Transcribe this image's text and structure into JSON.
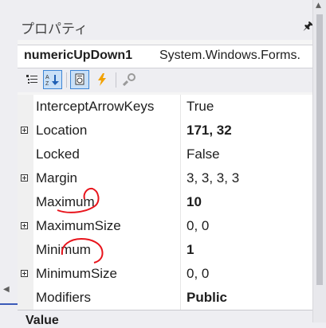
{
  "panel": {
    "title": "プロパティ",
    "pin_icon": "pin-icon"
  },
  "object": {
    "name": "numericUpDown1",
    "type": "System.Windows.Forms."
  },
  "toolbar": {
    "buttons": [
      {
        "icon": "categorized-icon",
        "active": false
      },
      {
        "icon": "alphabetical-icon",
        "active": true
      },
      {
        "icon": "properties-icon",
        "active": true
      },
      {
        "icon": "events-icon",
        "active": false
      },
      {
        "icon": "property-pages-icon",
        "active": false
      }
    ]
  },
  "properties": [
    {
      "name": "InterceptArrowKeys",
      "value": "True",
      "expandable": false,
      "bold": false
    },
    {
      "name": "Location",
      "value": "171, 32",
      "expandable": true,
      "bold": true
    },
    {
      "name": "Locked",
      "value": "False",
      "expandable": false,
      "bold": false
    },
    {
      "name": "Margin",
      "value": "3, 3, 3, 3",
      "expandable": true,
      "bold": false
    },
    {
      "name": "Maximum",
      "value": "10",
      "expandable": false,
      "bold": true
    },
    {
      "name": "MaximumSize",
      "value": "0, 0",
      "expandable": true,
      "bold": false
    },
    {
      "name": "Minimum",
      "value": "1",
      "expandable": false,
      "bold": true
    },
    {
      "name": "MinimumSize",
      "value": "0, 0",
      "expandable": true,
      "bold": false
    },
    {
      "name": "Modifiers",
      "value": "Public",
      "expandable": false,
      "bold": true
    }
  ],
  "description": {
    "label": "Value"
  },
  "colors": {
    "annotation": "#e8141c",
    "selection": "#c9e0f7",
    "accent": "#3d86d6"
  }
}
